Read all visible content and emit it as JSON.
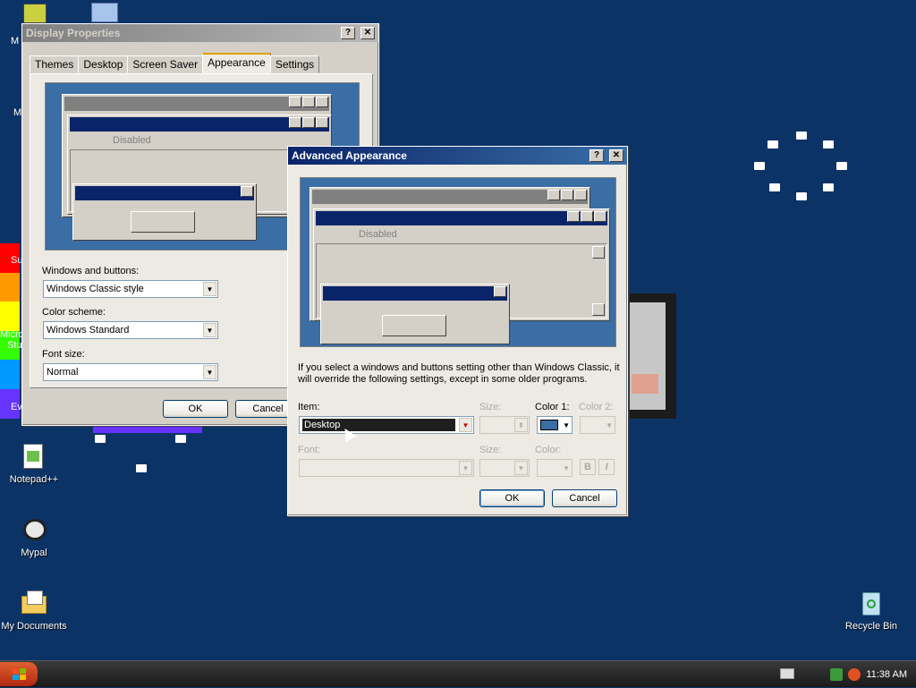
{
  "desktop": {
    "icons": [
      {
        "label": "Notepad++",
        "name": "notepad-plus-plus-icon"
      },
      {
        "label": "Mypal",
        "name": "mypal-icon"
      },
      {
        "label": "My Documents",
        "name": "my-documents-icon"
      },
      {
        "label": "Recycle Bin",
        "name": "recycle-bin-icon"
      }
    ],
    "partial_labels": [
      "M",
      "M",
      "Su",
      "Micro",
      "Stu",
      "Ev"
    ]
  },
  "display_properties": {
    "title": "Display Properties",
    "tabs": [
      "Themes",
      "Desktop",
      "Screen Saver",
      "Appearance",
      "Settings"
    ],
    "preview_disabled": "Disabled",
    "windows_buttons_label": "Windows and buttons:",
    "windows_buttons_value": "Windows Classic style",
    "color_scheme_label": "Color scheme:",
    "color_scheme_value": "Windows Standard",
    "font_size_label": "Font size:",
    "font_size_value": "Normal",
    "ok": "OK",
    "cancel": "Cancel"
  },
  "advanced": {
    "title": "Advanced Appearance",
    "preview_disabled": "Disabled",
    "info": "If you select a windows and buttons setting other than Windows Classic, it will override the following settings, except in some older programs.",
    "item_label": "Item:",
    "item_value": "Desktop",
    "size_label": "Size:",
    "color1_label": "Color 1:",
    "color2_label": "Color 2:",
    "font_label": "Font:",
    "size2_label": "Size:",
    "color_label": "Color:",
    "bold": "B",
    "italic": "I",
    "ok": "OK",
    "cancel": "Cancel",
    "color1_value": "#3a6ea5"
  },
  "taskbar": {
    "clock": "11:38 AM"
  },
  "colors": {
    "desktop_bg": "#0c3366",
    "title_active": "#0a246a",
    "preview_bg": "#3a6ea5"
  }
}
